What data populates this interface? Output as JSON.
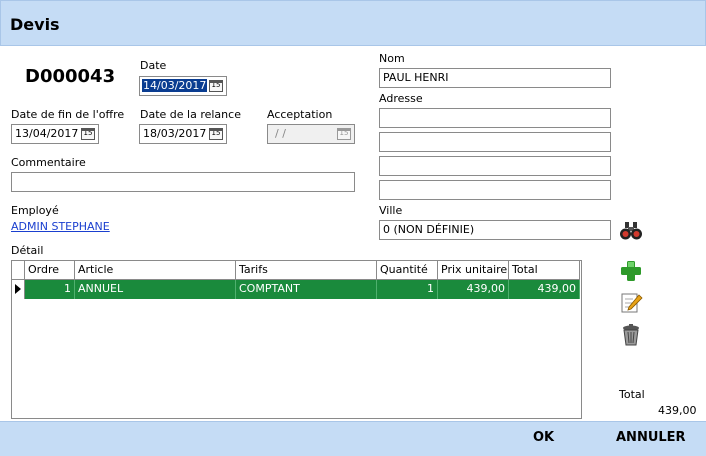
{
  "window": {
    "title": "Devis"
  },
  "quote": {
    "number": "D000043"
  },
  "date": {
    "label": "Date",
    "value": "14/03/2017"
  },
  "offer_end": {
    "label": "Date de fin de l'offre",
    "value": "13/04/2017"
  },
  "reminder": {
    "label": "Date de la relance",
    "value": "18/03/2017"
  },
  "acceptance": {
    "label": "Acceptation",
    "value": " / /"
  },
  "comment": {
    "label": "Commentaire",
    "value": ""
  },
  "employee": {
    "label": "Employé",
    "value": "ADMIN STEPHANE"
  },
  "client": {
    "name_label": "Nom",
    "name": "PAUL HENRI",
    "address_label": "Adresse",
    "address": [
      "",
      "",
      "",
      ""
    ],
    "city_label": "Ville",
    "city": "0 (NON DÉFINIE)"
  },
  "detail": {
    "label": "Détail",
    "columns": [
      "Ordre",
      "Article",
      "Tarifs",
      "Quantité",
      "Prix unitaire",
      "Total"
    ],
    "rows": [
      {
        "ordre": "1",
        "article": "ANNUEL",
        "tarifs": "COMPTANT",
        "quantite": "1",
        "prix": "439,00",
        "total": "439,00"
      }
    ]
  },
  "total": {
    "label": "Total",
    "value": "439,00"
  },
  "icons": [
    "binoculars-icon",
    "add-icon",
    "edit-icon",
    "trash-icon"
  ],
  "buttons": {
    "ok": "OK",
    "cancel": "ANNULER"
  },
  "colors": {
    "header_bg": "#c5dcf5",
    "row_selected": "#1a8a3c",
    "link": "#1a3fcf",
    "selection": "#0a3d91"
  }
}
